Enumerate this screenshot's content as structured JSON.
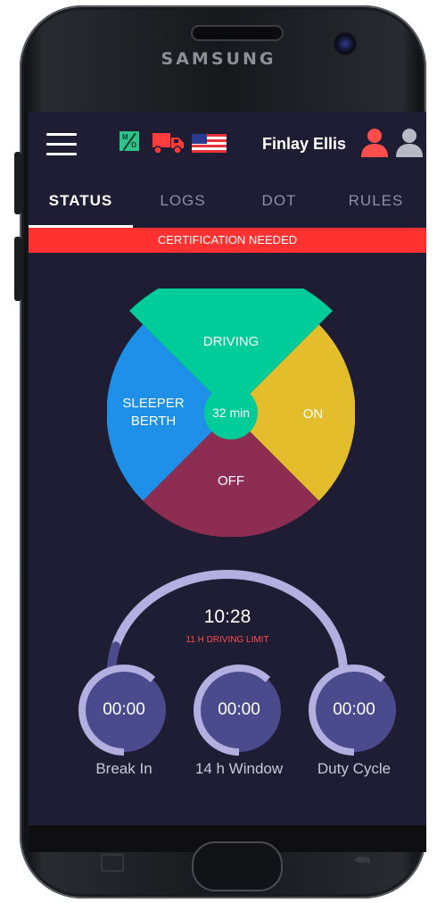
{
  "device": {
    "brand": "SAMSUNG"
  },
  "header": {
    "menu_icon": "hamburger-menu-icon",
    "md_badge": {
      "top": "M",
      "bottom": "D"
    },
    "user_name": "Finlay Ellis",
    "colors": {
      "background": "#1e1d33",
      "accent_red": "#ff3131",
      "user_active": "#ff4d4d",
      "user_inactive": "#b9b9c6"
    }
  },
  "tabs": [
    {
      "label": "STATUS",
      "active": true
    },
    {
      "label": "LOGS",
      "active": false
    },
    {
      "label": "DOT",
      "active": false
    },
    {
      "label": "RULES",
      "active": false
    }
  ],
  "banner": {
    "text": "CERTIFICATION NEEDED",
    "color": "#ff3131"
  },
  "status_wheel": {
    "center_text": "32 min",
    "segments": [
      {
        "key": "driving",
        "label": "DRIVING",
        "color": "#00cc99"
      },
      {
        "key": "on",
        "label": "ON",
        "color": "#e3bd2c"
      },
      {
        "key": "off",
        "label": "OFF",
        "color": "#8e2d52"
      },
      {
        "key": "sleeper",
        "label_line1": "SLEEPER",
        "label_line2": "BERTH",
        "color": "#1e90e8"
      }
    ]
  },
  "timers": {
    "main_time": "10:28",
    "limit_label": "11 H DRIVING LIMIT",
    "main_arc_progress": 0.08,
    "gauges": [
      {
        "value": "00:00",
        "label": "Break In",
        "progress": 0.62
      },
      {
        "value": "00:00",
        "label": "14 h Window",
        "progress": 0.62
      },
      {
        "value": "00:00",
        "label": "Duty Cycle",
        "progress": 0.62
      }
    ]
  }
}
